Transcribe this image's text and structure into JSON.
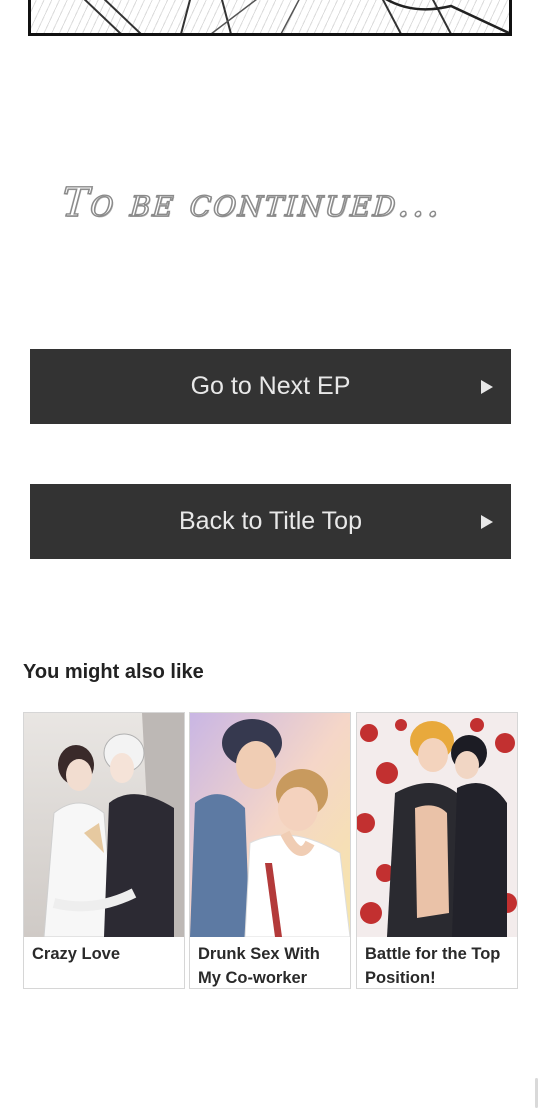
{
  "ending": {
    "to_be_continued": "To be continued..."
  },
  "navigation": {
    "next_label": "Go to Next EP",
    "back_label": "Back to Title Top",
    "arrow_icon": "play-arrow-icon"
  },
  "recommendations": {
    "heading": "You might also like",
    "items": [
      {
        "title": "Crazy Love"
      },
      {
        "title": "Drunk Sex With My Co-worker"
      },
      {
        "title": "Battle for the Top Position!"
      }
    ]
  },
  "colors": {
    "button_bg": "#333333",
    "button_text": "#e8e8e8",
    "background": "#ffffff"
  }
}
